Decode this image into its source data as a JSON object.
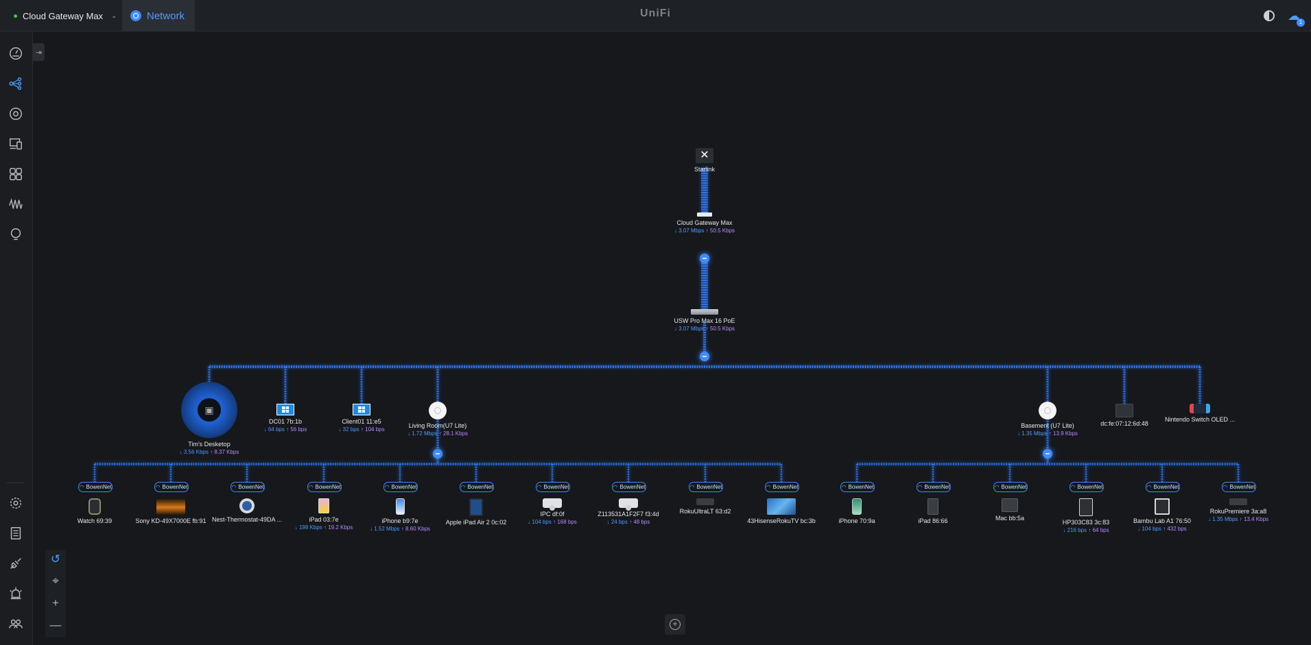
{
  "header": {
    "gateway_name": "Cloud Gateway Max",
    "tab_label": "Network",
    "brand": "UniFi",
    "notification_count": "1"
  },
  "sidebar": {
    "items": [
      "dashboard",
      "topology",
      "unifi-devices",
      "client-devices",
      "ports",
      "insights",
      "alerts"
    ],
    "bottom_items": [
      "settings",
      "logs",
      "integrations",
      "alarm",
      "admins"
    ]
  },
  "colors": {
    "accent": "#3f8cff",
    "download": "#4f9bff",
    "upload": "#b58cff",
    "online": "#35c759"
  },
  "topology": {
    "isp": {
      "name": "Starlink",
      "icon": "starlink-icon"
    },
    "gateway": {
      "name": "Cloud Gateway Max",
      "down": "↓ 3.07 Mbps",
      "up": "↑ 50.5 Kbps",
      "icon": "gateway-icon"
    },
    "switch": {
      "name": "USW Pro Max 16 PoE",
      "down": "↓ 3.07 Mbps",
      "up": "↑ 50.5 Kbps",
      "icon": "switch-icon"
    },
    "level1": [
      {
        "name": "Tim's Desketop",
        "down": "↓ 3.56 Kbps",
        "up": "↑ 8.37 Kbps",
        "icon": "desktop-avatar-icon",
        "selected": true
      },
      {
        "name": "DC01 7b:1b",
        "down": "↓ 64 bps",
        "up": "↑ 56 bps",
        "icon": "windows-icon"
      },
      {
        "name": "Client01 11:e5",
        "down": "↓ 32 bps",
        "up": "↑ 104 bps",
        "icon": "windows-icon"
      },
      {
        "name": "Living Room(U7 Lite)",
        "down": "↓ 1.72 Mbps",
        "up": "↑ 28.1 Kbps",
        "icon": "access-point-icon"
      },
      {
        "name": "Basement (U7 Lite)",
        "down": "↓ 1.35 Mbps",
        "up": "↑ 13.9 Kbps",
        "icon": "access-point-icon"
      },
      {
        "name": "dc:fe:07:12:6d:48",
        "down": "",
        "up": "",
        "icon": "monitor-icon"
      },
      {
        "name": "Nintendo Switch OLED ...",
        "down": "",
        "up": "",
        "icon": "nintendo-switch-icon"
      }
    ],
    "living_room_clients": [
      {
        "ssid": "BowenNet",
        "name": "Watch 69:39",
        "down": "",
        "up": "",
        "icon": "watch-icon"
      },
      {
        "ssid": "BowenNet",
        "name": "Sony KD-49X7000E fb:91",
        "down": "",
        "up": "",
        "icon": "tv-sunset-icon"
      },
      {
        "ssid": "BowenNet",
        "name": "Nest-Thermostat-49DA ...",
        "down": "",
        "up": "",
        "icon": "thermostat-icon"
      },
      {
        "ssid": "BowenNet",
        "name": "iPad 03:7e",
        "down": "↓ 198 Kbps",
        "up": "↑ 19.2 Kbps",
        "icon": "ipad-icon"
      },
      {
        "ssid": "BowenNet",
        "name": "iPhone b9:7e",
        "down": "↓ 1.52 Mbps",
        "up": "↑ 8.60 Kbps",
        "icon": "iphone-icon"
      },
      {
        "ssid": "BowenNet",
        "name": "Apple iPad Air 2 0c:02",
        "down": "",
        "up": "",
        "icon": "ipad-air-icon"
      },
      {
        "ssid": "BowenNet",
        "name": "IPC df:0f",
        "down": "↓ 104 bps",
        "up": "↑ 168 bps",
        "icon": "camera-icon"
      },
      {
        "ssid": "BowenNet",
        "name": "Z113531A1F2F7 f3:4d",
        "down": "↓ 24 bps",
        "up": "↑ 48 bps",
        "icon": "camera-icon"
      },
      {
        "ssid": "BowenNet",
        "name": "RokuUltraLT 63:d2",
        "down": "",
        "up": "",
        "icon": "roku-icon"
      },
      {
        "ssid": "BowenNet",
        "name": "43HisenseRokuTV bc:3b",
        "down": "",
        "up": "",
        "icon": "tv-icon"
      }
    ],
    "basement_clients": [
      {
        "ssid": "BowenNet",
        "name": "iPhone 70:9a",
        "down": "",
        "up": "",
        "icon": "iphone-green-icon"
      },
      {
        "ssid": "BowenNet",
        "name": "iPad 86:66",
        "down": "",
        "up": "",
        "icon": "ipad-dark-icon"
      },
      {
        "ssid": "BowenNet",
        "name": "Mac bb:5a",
        "down": "",
        "up": "",
        "icon": "mac-icon"
      },
      {
        "ssid": "BowenNet",
        "name": "HP303C83 3c:83",
        "down": "↓ 216 bps",
        "up": "↑ 64 bps",
        "icon": "printer-icon"
      },
      {
        "ssid": "BowenNet",
        "name": "Bambu Lab A1 76:50",
        "down": "↓ 104 bps",
        "up": "↑ 432 bps",
        "icon": "3d-printer-icon"
      },
      {
        "ssid": "BowenNet",
        "name": "RokuPremiere 3a:a8",
        "down": "↓ 1.35 Mbps",
        "up": "↑ 13.4 Kbps",
        "icon": "roku-icon"
      }
    ]
  }
}
